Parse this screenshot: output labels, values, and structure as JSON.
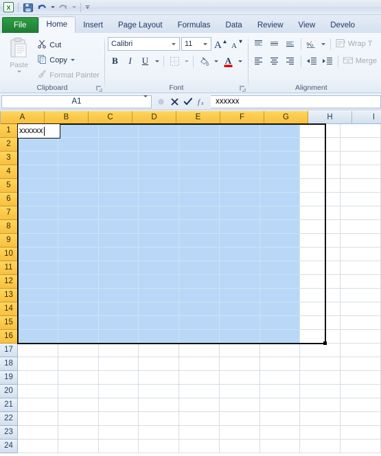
{
  "quick_access": {
    "app_icon": "excel-icon",
    "buttons": [
      {
        "name": "save-button",
        "icon": "floppy-disk-icon",
        "enabled": true
      },
      {
        "name": "undo-button",
        "icon": "undo-arrow-icon",
        "enabled": true,
        "has_dropdown": true
      },
      {
        "name": "redo-button",
        "icon": "redo-arrow-icon",
        "enabled": false,
        "has_dropdown": true
      },
      {
        "name": "customize-qat-button",
        "icon": "chevron-down-icon",
        "enabled": true
      }
    ]
  },
  "ribbon": {
    "tabs": [
      {
        "label": "File",
        "active": false,
        "kind": "file"
      },
      {
        "label": "Home",
        "active": true,
        "kind": "normal"
      },
      {
        "label": "Insert",
        "active": false,
        "kind": "normal"
      },
      {
        "label": "Page Layout",
        "active": false,
        "kind": "normal"
      },
      {
        "label": "Formulas",
        "active": false,
        "kind": "normal"
      },
      {
        "label": "Data",
        "active": false,
        "kind": "normal"
      },
      {
        "label": "Review",
        "active": false,
        "kind": "normal"
      },
      {
        "label": "View",
        "active": false,
        "kind": "normal"
      },
      {
        "label": "Develo",
        "active": false,
        "kind": "normal"
      }
    ],
    "groups": {
      "clipboard": {
        "label": "Clipboard",
        "paste_label": "Paste",
        "cut_label": "Cut",
        "copy_label": "Copy",
        "format_painter_label": "Format Painter"
      },
      "font": {
        "label": "Font",
        "font_name": "Calibri",
        "font_size": "11",
        "bold_label": "B",
        "italic_label": "I",
        "underline_label": "U"
      },
      "alignment": {
        "label": "Alignment",
        "wrap_text_label": "Wrap T",
        "merge_label": "Merge"
      }
    }
  },
  "formula_bar": {
    "name_box_value": "A1",
    "cancel_icon": "x-icon",
    "enter_icon": "check-icon",
    "function_icon": "fx-icon",
    "formula_value": "xxxxxx"
  },
  "grid": {
    "columns": [
      "A",
      "B",
      "C",
      "D",
      "E",
      "F",
      "G",
      "H",
      "I"
    ],
    "selected_columns": [
      "A",
      "B",
      "C",
      "D",
      "E",
      "F",
      "G"
    ],
    "rows": [
      "1",
      "2",
      "3",
      "4",
      "5",
      "6",
      "7",
      "8",
      "9",
      "10",
      "11",
      "12",
      "13",
      "14",
      "15",
      "16",
      "17",
      "18",
      "19",
      "20",
      "21",
      "22",
      "23",
      "24"
    ],
    "selected_rows": [
      "1",
      "2",
      "3",
      "4",
      "5",
      "6",
      "7",
      "8",
      "9",
      "10",
      "11",
      "12",
      "13",
      "14",
      "15",
      "16"
    ],
    "selection_range": "A1:G16",
    "active_cell": "A1",
    "active_cell_value": "xxxxxx",
    "editing": true
  },
  "colors": {
    "accent_green": "#2f9e44",
    "header_selected": "#fbc94a",
    "selection_fill": "#b9d8f7",
    "ribbon_bg": "#eef4fa",
    "font_color_swatch": "#e00000"
  }
}
